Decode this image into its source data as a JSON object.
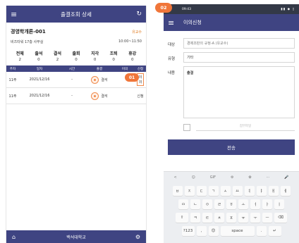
{
  "left_screen": {
    "title": "출결조회 상세",
    "course_name": "경영학개론-001",
    "professor": "유교수",
    "room": "비즈타워 17층 사무실",
    "time": "10:00~11:50",
    "stats": [
      {
        "label": "전체",
        "value": "2"
      },
      {
        "label": "출석",
        "value": "0"
      },
      {
        "label": "결석",
        "value": "2"
      },
      {
        "label": "출회",
        "value": "0"
      },
      {
        "label": "지각",
        "value": "0"
      },
      {
        "label": "조퇴",
        "value": "0"
      },
      {
        "label": "휴강",
        "value": "0"
      }
    ],
    "table_headers": [
      "주차",
      "일자",
      "시간",
      "출결",
      "이의",
      "신청"
    ],
    "rows": [
      {
        "week": "11주",
        "date": "2021/12/16",
        "time": "-",
        "status": "결석",
        "action": "이의"
      },
      {
        "week": "11주",
        "date": "2021/12/16",
        "time": "-",
        "status": "결석",
        "action": "신청"
      }
    ],
    "callout_badge": "01",
    "bottom_label": "백석대학교"
  },
  "right_screen": {
    "callout_badge": "02",
    "status_time": "09:43",
    "status_icons": "▮▮ ◆ ▯",
    "title": "이의신청",
    "fields": [
      {
        "label": "대상",
        "value": "경제조판의 규정-A (유교수)"
      },
      {
        "label": "유형",
        "value": "기타"
      },
      {
        "label": "내용",
        "value": "출결"
      }
    ],
    "attachment_placeholder": "첨부파일",
    "submit_label": "전송",
    "keyboard": {
      "toolbar": [
        "<",
        "☺",
        "GIF",
        "⚙",
        "✿",
        "···",
        "🎤"
      ],
      "rows": [
        [
          "ㅂ",
          "ㅈ",
          "ㄷ",
          "ㄱ",
          "ㅅ",
          "ㅛ",
          "ㅕ",
          "ㅑ",
          "ㅐ",
          "ㅔ"
        ],
        [
          "ㅁ",
          "ㄴ",
          "ㅇ",
          "ㄹ",
          "ㅎ",
          "ㅗ",
          "ㅓ",
          "ㅏ",
          "ㅣ"
        ],
        [
          "⇧",
          "ㅋ",
          "ㅌ",
          "ㅊ",
          "ㅍ",
          "ㅠ",
          "ㅜ",
          "ㅡ",
          "⌫"
        ],
        [
          "?123",
          ",",
          "😊",
          "space",
          ".",
          "↵"
        ]
      ]
    }
  },
  "colors": {
    "primary": "#3f4482",
    "accent": "#f0763a"
  }
}
